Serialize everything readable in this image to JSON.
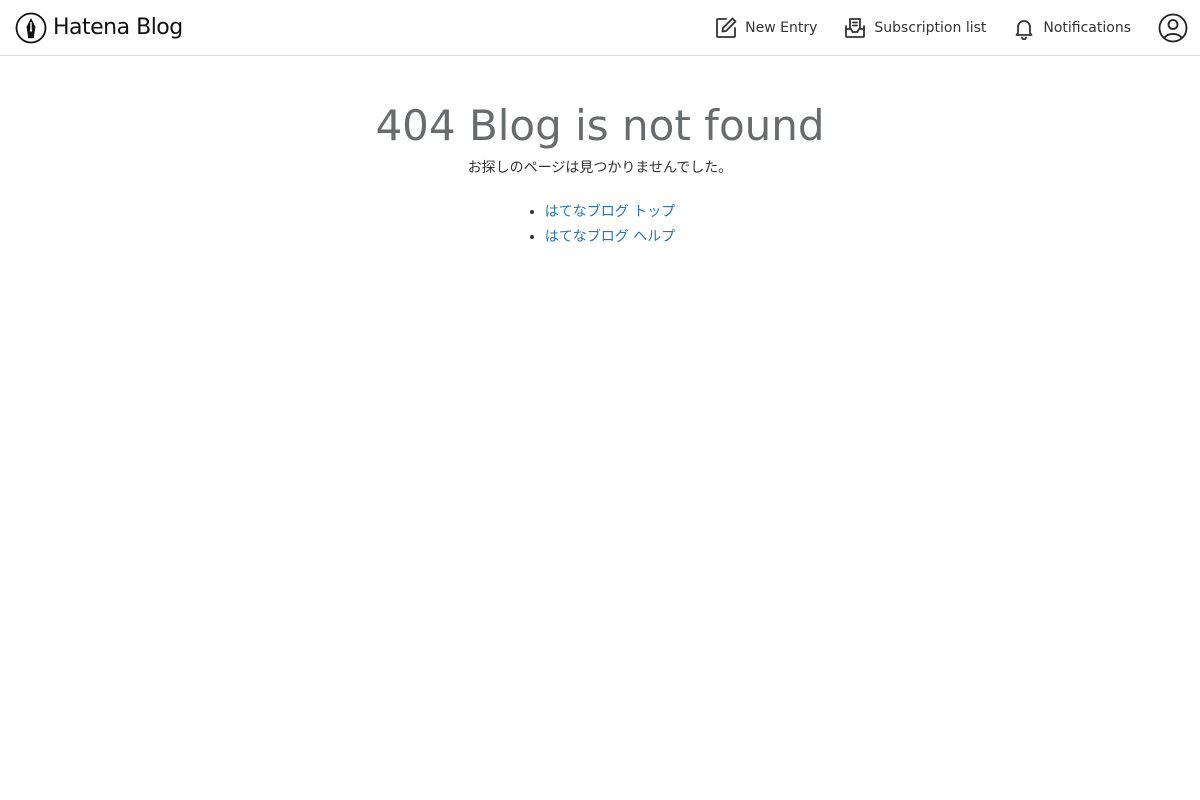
{
  "header": {
    "logo_text": "Hatena Blog",
    "nav": {
      "new_entry_label": "New Entry",
      "subscription_label": "Subscription list",
      "notifications_label": "Notifications"
    },
    "icons": [
      "pen-nib-icon",
      "edit-icon",
      "inbox-icon",
      "bell-icon",
      "user-icon"
    ]
  },
  "main": {
    "title": "404 Blog is not found",
    "message": "お探しのページは見つかりませんでした。",
    "links": [
      {
        "label": "はてなブログ トップ"
      },
      {
        "label": "はてなブログ ヘルプ"
      }
    ]
  },
  "colors": {
    "title": "#686c6e",
    "link": "#2a73b9",
    "header_border": "#dddddd",
    "text": "#333333"
  }
}
